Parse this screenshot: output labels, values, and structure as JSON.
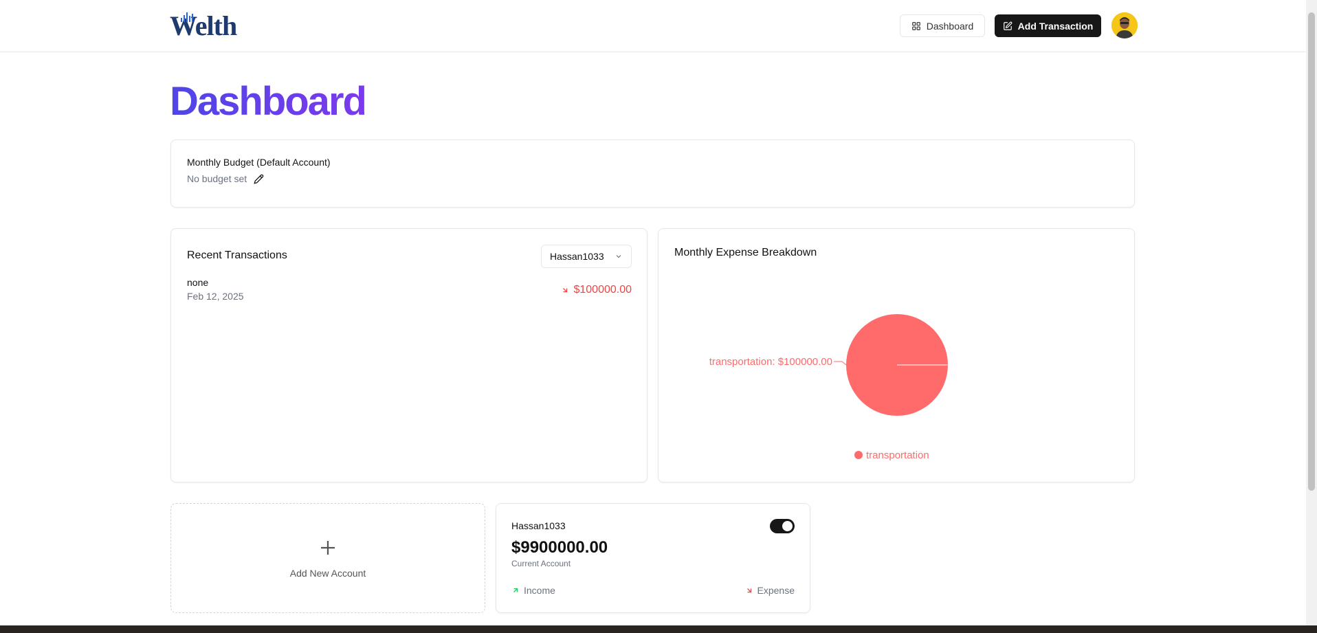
{
  "header": {
    "logo_text": "Welth",
    "dashboard_button": "Dashboard",
    "add_transaction_button": "Add Transaction"
  },
  "page": {
    "title": "Dashboard"
  },
  "budget": {
    "title": "Monthly Budget (Default Account)",
    "status": "No budget set"
  },
  "recent_transactions": {
    "title": "Recent Transactions",
    "selected_account": "Hassan1033",
    "items": [
      {
        "description": "none",
        "date": "Feb 12, 2025",
        "amount": "$100000.00",
        "type": "expense"
      }
    ]
  },
  "expense_breakdown": {
    "title": "Monthly Expense Breakdown"
  },
  "chart_data": {
    "type": "pie",
    "categories": [
      "transportation"
    ],
    "values": [
      100000.0
    ],
    "slice_labels": [
      "transportation: $100000.00"
    ],
    "legend": [
      "transportation"
    ],
    "legend_position": "bottom",
    "colors": [
      "#ff6b6b"
    ]
  },
  "accounts": {
    "add_new_label": "Add New Account",
    "items": [
      {
        "name": "Hassan1033",
        "balance": "$9900000.00",
        "type": "Current Account",
        "income_label": "Income",
        "expense_label": "Expense",
        "is_default": true
      }
    ]
  },
  "colors": {
    "accent_gradient_start": "#4f46e5",
    "accent_gradient_end": "#7c3aed",
    "expense": "#ef4444",
    "income": "#22c55e",
    "pie": "#ff6b6b"
  }
}
